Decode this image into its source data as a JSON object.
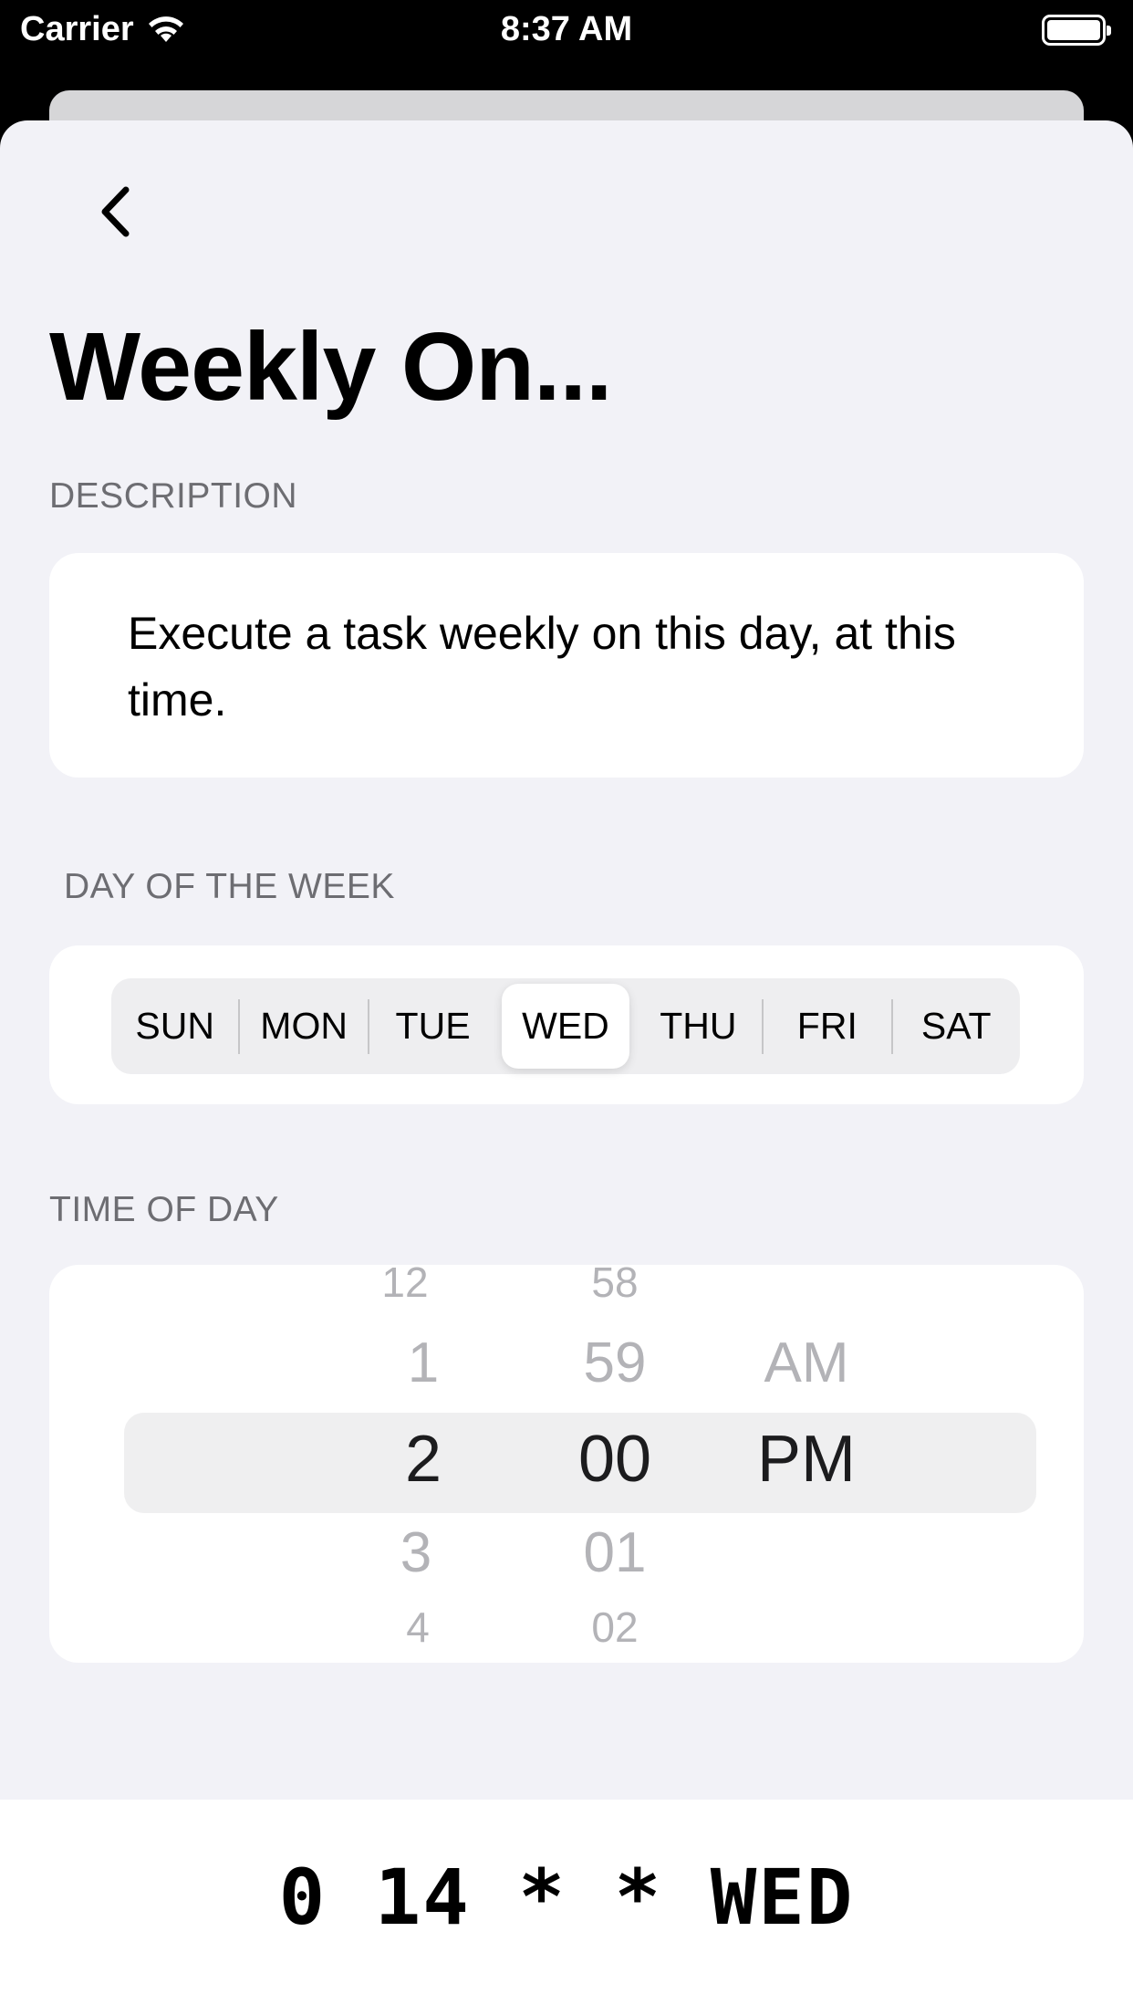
{
  "status_bar": {
    "carrier": "Carrier",
    "time": "8:37 AM",
    "battery_level": 1.0
  },
  "header": {
    "back_icon": "chevron-left-icon",
    "title": "Weekly On..."
  },
  "description": {
    "section_label": "DESCRIPTION",
    "text": "Execute a task weekly on this day, at this time."
  },
  "day_of_week": {
    "section_label": "DAY OF THE WEEK",
    "options": [
      "SUN",
      "MON",
      "TUE",
      "WED",
      "THU",
      "FRI",
      "SAT"
    ],
    "selected": "WED"
  },
  "time_of_day": {
    "section_label": "TIME OF DAY",
    "hour_wheel": [
      "12",
      "1",
      "2",
      "3",
      "4"
    ],
    "minute_wheel": [
      "58",
      "59",
      "00",
      "01",
      "02"
    ],
    "period_wheel": [
      "AM",
      "PM"
    ],
    "selected": {
      "hour": "2",
      "minute": "00",
      "period": "PM"
    }
  },
  "cron_expression": "0 14 * * WED",
  "colors": {
    "background": "#f2f2f7",
    "card": "#ffffff",
    "secondary_text": "#6d6d72"
  }
}
